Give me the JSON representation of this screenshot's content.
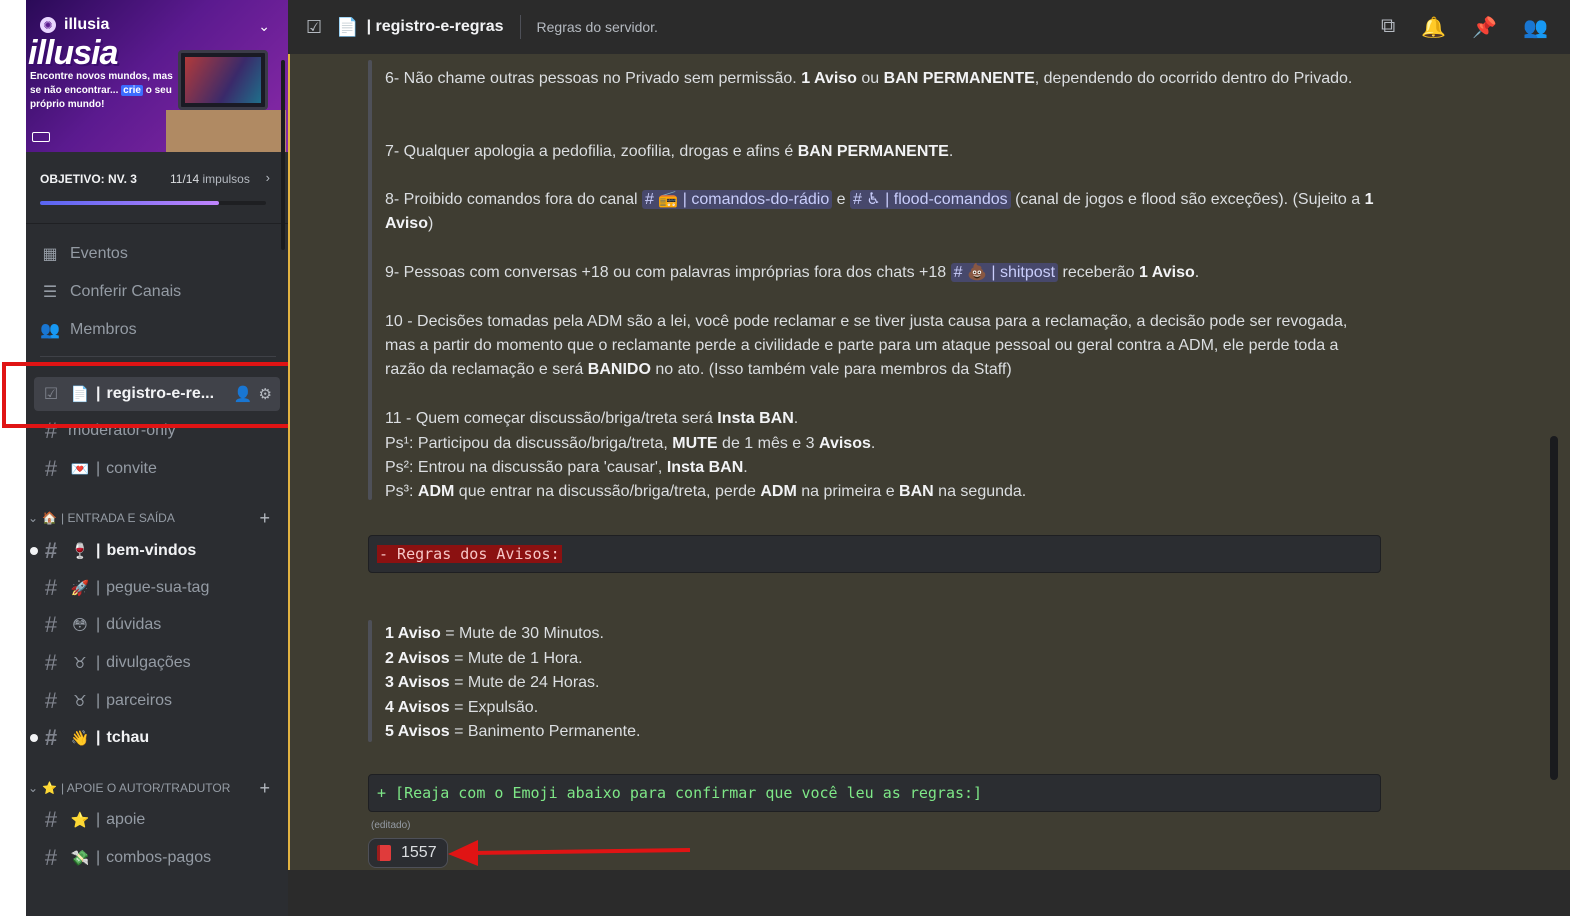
{
  "server": {
    "name": "illusia",
    "logo": "illusia",
    "tagline_a": "Encontre novos mundos, mas se não encontrar...",
    "tagline_hl": "crie",
    "tagline_b": "o seu próprio mundo!",
    "boost_goal": "OBJETIVO: NV. 3",
    "boost_count": "11/14",
    "boost_unit": "impulsos",
    "boost_progress": 0.79
  },
  "nav": [
    {
      "label": "Eventos",
      "icon": "calendar-icon"
    },
    {
      "label": "Conferir Canais",
      "icon": "browse-channels-icon"
    },
    {
      "label": "Membros",
      "icon": "members-icon"
    }
  ],
  "channels_top": {
    "active": {
      "label": "registro-e-re...",
      "pipe": "|"
    },
    "moderator": {
      "label": "moderator-only"
    },
    "convite": {
      "emoji": "💌",
      "label": "convite",
      "pipe": "|"
    }
  },
  "category1": {
    "emoji": "🏠",
    "label": "| ENTRADA E SAÍDA"
  },
  "channels_cat1": [
    {
      "emoji": "🍷",
      "label": "bem-vindos",
      "unread": true
    },
    {
      "emoji": "🚀",
      "label": "pegue-sua-tag",
      "unread": false
    },
    {
      "emoji": "😳",
      "label": "dúvidas",
      "unread": false
    },
    {
      "emoji": "♉",
      "label": "divulgações",
      "unread": false
    },
    {
      "emoji": "♉",
      "label": "parceiros",
      "unread": false
    },
    {
      "emoji": "👋",
      "label": "tchau",
      "unread": true
    }
  ],
  "category2": {
    "emoji": "⭐",
    "label": "| APOIE O AUTOR/TRADUTOR"
  },
  "channels_cat2": [
    {
      "emoji": "⭐",
      "label": "apoie"
    },
    {
      "emoji": "💸",
      "label": "combos-pagos"
    }
  ],
  "header": {
    "title": "| registro-e-regras",
    "topic": "Regras do servidor."
  },
  "message": {
    "rule6_a": "6- Não chame outras pessoas no Privado sem permissão.",
    "rule6_b1": "1 Aviso",
    "rule6_c": "ou",
    "rule6_b2": "BAN PERMANENTE",
    "rule6_d": ", dependendo do ocorrido dentro do Privado.",
    "rule7_a": "7- Qualquer apologia a pedofilia, zoofilia, drogas e afins é",
    "rule7_b": "BAN PERMANENTE",
    "rule7_c": ".",
    "rule8_a": "8- Proibido comandos fora do canal",
    "rule8_m1": "# 📻 | comandos-do-rádio",
    "rule8_and": "e",
    "rule8_m2": "# ♿ | flood-comandos",
    "rule8_b": "(canal de jogos e flood são exceções). (Sujeito a",
    "rule8_c": "1 Aviso",
    "rule8_d": ")",
    "rule9_a": "9- Pessoas com conversas +18 ou com palavras impróprias fora dos chats +18",
    "rule9_m": "# 💩 | shitpost",
    "rule9_b": "receberão",
    "rule9_c": "1 Aviso",
    "rule9_d": ".",
    "rule10_a": "10 - Decisões tomadas pela ADM são a lei, você pode reclamar e se tiver justa causa para a reclamação, a decisão pode ser revogada, mas a partir do momento que o reclamante perde a civilidade e parte para um ataque pessoal ou geral contra a ADM, ele perde toda a razão da reclamação e será",
    "rule10_b": "BANIDO",
    "rule10_c": "no ato. (Isso também vale para membros da Staff)",
    "rule11_a": "11 - Quem começar discussão/briga/treta será",
    "rule11_b": "Insta BAN",
    "rule11_c": ".",
    "ps1_a": "Ps¹: Participou da discussão/briga/treta,",
    "ps1_b": "MUTE",
    "ps1_c": "de 1 mês e 3",
    "ps1_d": "Avisos",
    "ps1_e": ".",
    "ps2_a": "Ps²: Entrou na discussão para 'causar',",
    "ps2_b": "Insta BAN",
    "ps2_c": ".",
    "ps3_a": "Ps³:",
    "ps3_b": "ADM",
    "ps3_c": "que entrar na discussão/briga/treta, perde",
    "ps3_d": "ADM",
    "ps3_e": "na primeira e",
    "ps3_f": "BAN",
    "ps3_g": "na segunda.",
    "code1": "- Regras dos Avisos:",
    "avisos": [
      {
        "k": "1 Aviso",
        "v": "= Mute de 30 Minutos."
      },
      {
        "k": "2 Avisos",
        "v": "= Mute de 1 Hora."
      },
      {
        "k": "3 Avisos",
        "v": "= Mute de 24 Horas."
      },
      {
        "k": "4 Avisos",
        "v": "= Expulsão."
      },
      {
        "k": "5 Avisos",
        "v": "= Banimento Permanente."
      }
    ],
    "code2": "+ [Reaja com o Emoji abaixo para confirmar que você leu as regras:]",
    "edited": "(editado)",
    "reaction_count": "1557"
  },
  "colors": {
    "annotation_red": "#e01414",
    "thread_gold": "#e3b341",
    "accent": "#5865f2"
  }
}
